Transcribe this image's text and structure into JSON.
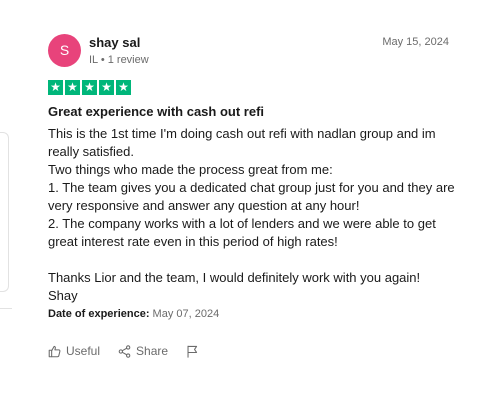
{
  "review": {
    "avatar_initial": "S",
    "reviewer_name": "shay sal",
    "reviewer_meta": "IL • 1 review",
    "date": "May 15, 2024",
    "rating": 5,
    "title": "Great experience with cash out refi",
    "body_lines": [
      "This is the 1st time I'm doing cash out refi with nadlan group and im really satisfied.",
      "Two things who made the process great from me:",
      "1. The team gives you a dedicated chat group just for you and they are very responsive and answer any question at any hour!",
      "2. The company works with a lot of lenders and we were able to get great interest rate even in this period of high rates!",
      "",
      "Thanks Lior and the team, I would definitely work with you again!",
      "Shay"
    ],
    "experience_label": "Date of experience:",
    "experience_date": "May 07, 2024"
  },
  "actions": {
    "useful_label": "Useful",
    "share_label": "Share"
  },
  "colors": {
    "avatar_bg": "#e8437b",
    "star_green": "#00b67a",
    "muted_text": "#6b6b6b"
  },
  "icons": [
    "thumbs-up-icon",
    "share-icon",
    "flag-icon",
    "star-icon"
  ]
}
